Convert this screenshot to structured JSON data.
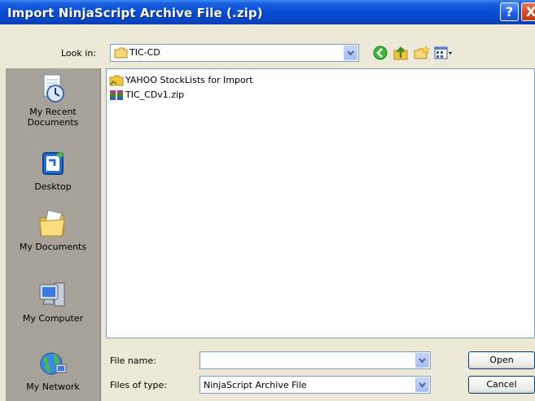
{
  "window": {
    "title": "Import NinjaScript Archive File (.zip)"
  },
  "titlebar": {
    "help_glyph": "?",
    "close_glyph": "X"
  },
  "toolbar": {
    "look_in_label": "Look in:",
    "look_in_value": "TIC-CD",
    "icons": [
      "back-icon",
      "up-folder-icon",
      "new-folder-icon",
      "views-menu-icon"
    ]
  },
  "places": [
    {
      "label": "My Recent Documents",
      "icon": "recent-documents-icon"
    },
    {
      "label": "Desktop",
      "icon": "desktop-icon"
    },
    {
      "label": "My Documents",
      "icon": "my-documents-icon"
    },
    {
      "label": "My Computer",
      "icon": "my-computer-icon"
    },
    {
      "label": "My Network",
      "icon": "my-network-icon"
    }
  ],
  "files": [
    {
      "name": "YAHOO StockLists for Import",
      "icon": "folder-icon"
    },
    {
      "name": "TIC_CDv1.zip",
      "icon": "archive-icon"
    }
  ],
  "form": {
    "file_name_label": "File name:",
    "file_name_value": "",
    "files_of_type_label": "Files of type:",
    "files_of_type_value": "NinjaScript Archive File",
    "open_label": "Open",
    "cancel_label": "Cancel"
  },
  "colors": {
    "titlebar": "#0a4fd6",
    "dialog_bg": "#ece9d8",
    "places_bg": "#a6a199"
  }
}
